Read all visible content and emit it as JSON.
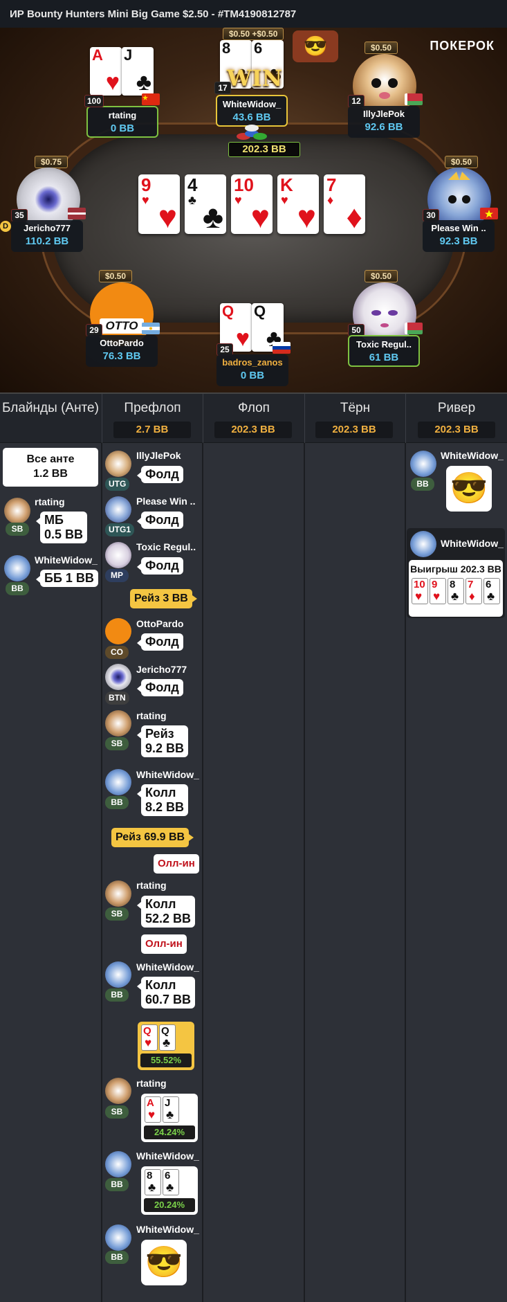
{
  "title": "ИР  Bounty Hunters Mini Big Game $2.50   - #TM4190812787",
  "logo": "ПОКЕРОК",
  "board": [
    {
      "rank": "9",
      "suit": "♥",
      "color": "red"
    },
    {
      "rank": "4",
      "suit": "♣",
      "color": "black"
    },
    {
      "rank": "10",
      "suit": "♥",
      "color": "red"
    },
    {
      "rank": "K",
      "suit": "♥",
      "color": "red"
    },
    {
      "rank": "7",
      "suit": "♦",
      "color": "red"
    }
  ],
  "pot": "202.3 BB",
  "seats": {
    "rtating": {
      "name": "rtating",
      "stack": "0 BB",
      "level": "100"
    },
    "whitewidow": {
      "name": "WhiteWidow_",
      "stack": "43.6 BB",
      "bounty": "$0.50 +$0.50",
      "level": "17",
      "win": "WIN"
    },
    "illyjlepok": {
      "name": "IllyJlePok",
      "stack": "92.6 BB",
      "bounty": "$0.50",
      "level": "12"
    },
    "jericho": {
      "name": "Jericho777",
      "stack": "110.2 BB",
      "bounty": "$0.75",
      "level": "35",
      "dealer": "D"
    },
    "pleasewin": {
      "name": "Please Win ..",
      "stack": "92.3 BB",
      "bounty": "$0.50",
      "level": "30"
    },
    "ottopardo": {
      "name": "OttoPardo",
      "stack": "76.3 BB",
      "bounty": "$0.50",
      "level": "29",
      "brand": "OTTO"
    },
    "badros": {
      "name": "badros_zanos",
      "stack": "0 BB",
      "level": "25"
    },
    "toxic": {
      "name": "Toxic Regul..",
      "stack": "61 BB",
      "bounty": "$0.50",
      "level": "50"
    }
  },
  "hole_cards": {
    "rtating": [
      {
        "rank": "A",
        "suit": "♥",
        "color": "red"
      },
      {
        "rank": "J",
        "suit": "♣",
        "color": "black"
      }
    ],
    "whitewidow": [
      {
        "rank": "8",
        "suit": "♣",
        "color": "black"
      },
      {
        "rank": "6",
        "suit": "♣",
        "color": "black"
      }
    ],
    "badros": [
      {
        "rank": "Q",
        "suit": "♥",
        "color": "red"
      },
      {
        "rank": "Q",
        "suit": "♣",
        "color": "black"
      }
    ]
  },
  "columns": [
    {
      "title": "Блайнды (Анте)",
      "pot": ""
    },
    {
      "title": "Префлоп",
      "pot": "2.7 BB"
    },
    {
      "title": "Флоп",
      "pot": "202.3 BB"
    },
    {
      "title": "Тёрн",
      "pot": "202.3 BB"
    },
    {
      "title": "Ривер",
      "pot": "202.3 BB"
    }
  ],
  "blinds": {
    "ante_line1": "Все анте",
    "ante_line2": "1.2 BB",
    "rows": [
      {
        "name": "rtating",
        "pos": "SB",
        "line1": "МБ",
        "line2": "0.5 BB"
      },
      {
        "name": "WhiteWidow_",
        "pos": "BB",
        "line1": "ББ 1 BB",
        "line2": ""
      }
    ]
  },
  "preflop": {
    "actions": [
      {
        "name": "IllyJlePok",
        "pos": "UTG",
        "line1": "Фолд",
        "line2": ""
      },
      {
        "name": "Please Win ..",
        "pos": "UTG1",
        "line1": "Фолд",
        "line2": ""
      },
      {
        "name": "Toxic Regul..",
        "pos": "MP",
        "line1": "Фолд",
        "line2": ""
      },
      {
        "name": "OttoPardo",
        "pos": "CO",
        "line1": "Фолд",
        "line2": ""
      },
      {
        "name": "Jericho777",
        "pos": "BTN",
        "line1": "Фолд",
        "line2": ""
      },
      {
        "name": "rtating",
        "pos": "SB",
        "line1": "Рейз",
        "line2": "9.2 BB"
      },
      {
        "name": "WhiteWidow_",
        "pos": "BB",
        "line1": "Колл",
        "line2": "8.2 BB"
      },
      {
        "name": "rtating",
        "pos": "SB",
        "line1": "Колл",
        "line2": "52.2 BB"
      },
      {
        "name": "WhiteWidow_",
        "pos": "BB",
        "line1": "Колл",
        "line2": "60.7 BB"
      }
    ],
    "raise1": "Рейз 3 BB",
    "raise2": "Рейз 69.9 BB",
    "allin1": "Олл-ин",
    "allin2": "Олл-ин",
    "shows": [
      {
        "name": "",
        "pos": "",
        "equity": "55.52%"
      },
      {
        "name": "rtating",
        "pos": "SB",
        "equity": "24.24%"
      },
      {
        "name": "WhiteWidow_",
        "pos": "BB",
        "equity": "20.24%"
      },
      {
        "name": "WhiteWidow_",
        "pos": "BB",
        "equity": ""
      }
    ]
  },
  "river": {
    "rows": [
      {
        "name": "WhiteWidow_",
        "pos": "BB"
      },
      {
        "name": "WhiteWidow_",
        "pos": ""
      }
    ],
    "win_label": "Выигрыш 202.3 BB",
    "win_cards": [
      {
        "rank": "10",
        "suit": "♥",
        "color": "red"
      },
      {
        "rank": "9",
        "suit": "♥",
        "color": "red"
      },
      {
        "rank": "8",
        "suit": "♣",
        "color": "black"
      },
      {
        "rank": "7",
        "suit": "♦",
        "color": "red"
      },
      {
        "rank": "6",
        "suit": "♣",
        "color": "black"
      }
    ]
  }
}
